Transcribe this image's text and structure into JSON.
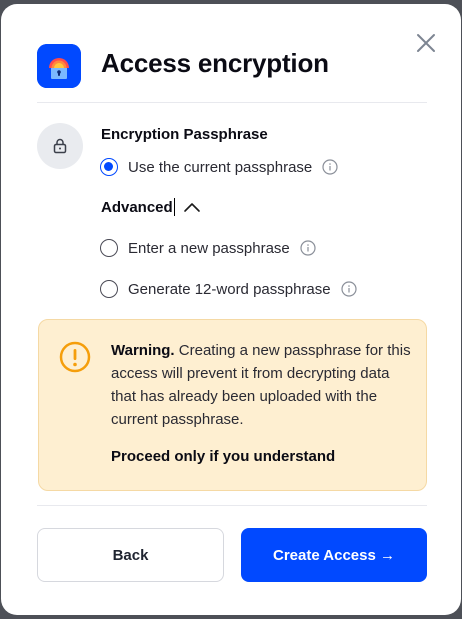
{
  "dialog": {
    "title": "Access encryption"
  },
  "section": {
    "title": "Encryption Passphrase"
  },
  "options": {
    "current": {
      "label": "Use the current passphrase",
      "checked": true
    },
    "new": {
      "label": "Enter a new passphrase",
      "checked": false
    },
    "generate": {
      "label": "Generate 12-word passphrase",
      "checked": false
    }
  },
  "advanced": {
    "label": "Advanced",
    "expanded": true
  },
  "warning": {
    "lead": "Warning.",
    "body": " Creating a new passphrase for this access will prevent it from decrypting data that has already been uploaded with the current passphrase.",
    "proceed": "Proceed only if you understand"
  },
  "buttons": {
    "back": "Back",
    "create": "Create Access →"
  },
  "colors": {
    "primary": "#0149ff",
    "warning_bg": "#feefd1",
    "warning_icon": "#f59e0b"
  },
  "icons": {
    "app": "rainbow-lock-icon",
    "close": "close-icon",
    "lock": "lock-icon",
    "info": "info-icon",
    "chevron": "chevron-up-icon",
    "warning": "exclamation-circle-icon"
  }
}
